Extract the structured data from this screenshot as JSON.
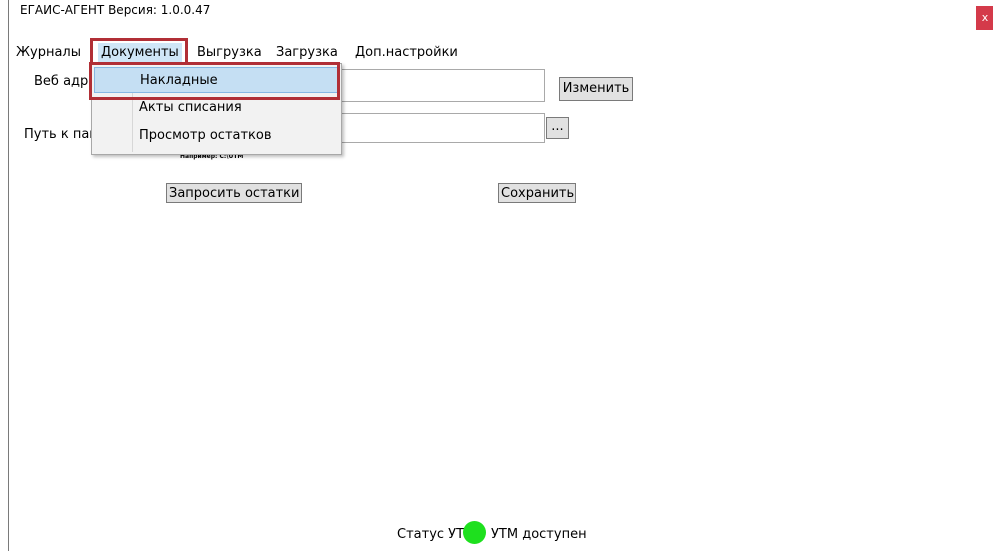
{
  "window": {
    "title": "ЕГАИС-АГЕНТ Версия: 1.0.0.47",
    "close_label": "x"
  },
  "menu": {
    "items": [
      {
        "label": "Журналы"
      },
      {
        "label": "Документы"
      },
      {
        "label": "Выгрузка"
      },
      {
        "label": "Загрузка"
      },
      {
        "label": "Доп.настройки"
      }
    ],
    "open_index": 1
  },
  "dropdown": {
    "items": [
      {
        "label": "Накладные",
        "selected": true
      },
      {
        "label": "Акты списания"
      },
      {
        "label": "Просмотр остатков"
      }
    ]
  },
  "form": {
    "web_address_label": "Веб адрес",
    "web_address_value": "",
    "change_button": "Изменить",
    "folder_path_label": "Путь к папке",
    "folder_path_value": "",
    "browse_button": "...",
    "folder_hint": "Например: C:\\UTM",
    "request_stock_button": "Запросить остатки",
    "save_button": "Сохранить"
  },
  "status": {
    "label": "Статус УТМ:",
    "text": "УТМ доступен",
    "color": "#1ee01e"
  },
  "colors": {
    "highlight": "#b12f36",
    "close": "#d43a4a"
  }
}
